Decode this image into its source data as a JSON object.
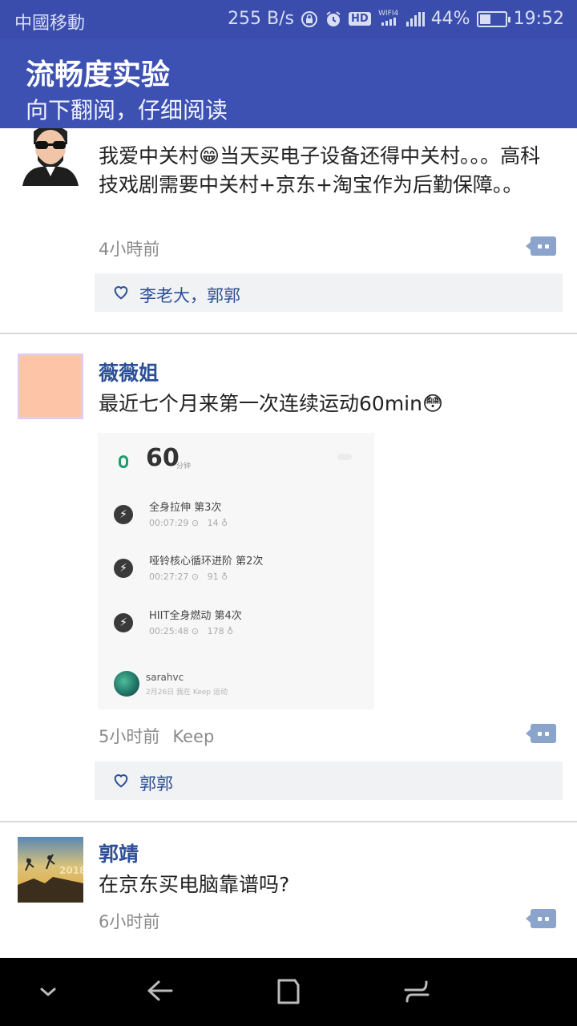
{
  "status_bar": {
    "carrier": "中國移動",
    "speed": "255 B/s",
    "hd": "HD",
    "wifi": "WIFI4",
    "battery_percent": "44%",
    "battery_level": 0.44,
    "time": "19:52"
  },
  "header": {
    "title": "流畅度实验",
    "subtitle": "向下翻阅，仔细阅读"
  },
  "posts": [
    {
      "text": "我爱中关村😁当天买电子设备还得中关村。。。高科技戏剧需要中关村+京东+淘宝作为后勤保障。。",
      "time": "4小時前",
      "likes": "李老大，郭郭"
    },
    {
      "name": "薇薇姐",
      "text": "最近七个月来第一次连续运动60min😳",
      "time": "5小时前",
      "source": "Keep",
      "likes": "郭郭",
      "activity": {
        "total": "60",
        "unit": "分钟",
        "items": [
          {
            "title": "全身拉伸 第3次",
            "duration": "00:07:29",
            "calories": "14"
          },
          {
            "title": "哑铃核心循环进阶 第2次",
            "duration": "00:27:27",
            "calories": "91"
          },
          {
            "title": "HIIT全身燃动 第4次",
            "duration": "00:25:48",
            "calories": "178"
          }
        ],
        "user": "sarahvc",
        "sub": "2月26日 我在 Keep 运动"
      }
    },
    {
      "name": "郭靖",
      "text": "在京东买电脑靠谱吗?",
      "time": "6小时前",
      "avatar_text": "2018"
    }
  ],
  "colors": {
    "status_bar": "#3b4dac",
    "title_bar": "#3d51b3",
    "name": "#2c4f96",
    "comment_icon": "#8aa4cb",
    "keep_green": "#1e9e6a"
  },
  "icons": [
    "lock-icon",
    "alarm-icon",
    "heart-icon",
    "comment-icon",
    "nav-down-icon",
    "nav-back-icon",
    "nav-home-icon",
    "nav-recent-icon"
  ]
}
